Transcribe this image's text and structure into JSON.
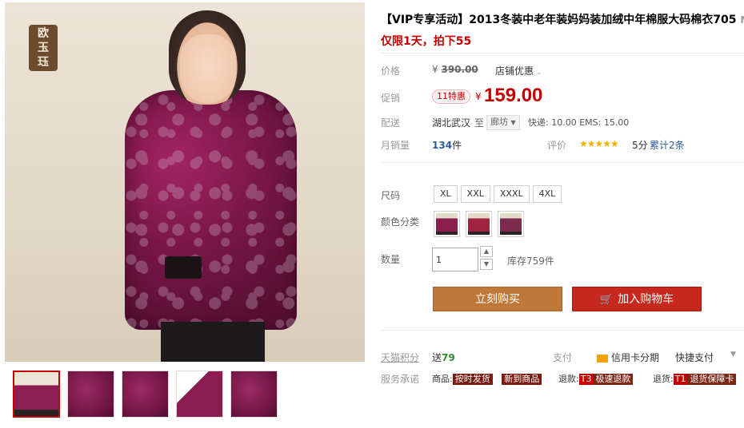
{
  "gallery": {
    "seal_text": "欧玉珏",
    "thumbnails": [
      "thumb-1",
      "thumb-2",
      "thumb-3",
      "thumb-4",
      "thumb-5"
    ]
  },
  "product": {
    "title": "【VIP专享活动】2013冬装中老年装妈妈装加绒中年棉服大码棉衣705",
    "title_suffix": "M",
    "promo_line": "仅限1天，拍下55"
  },
  "price": {
    "label": "价格",
    "currency": "¥",
    "original": "390.00",
    "shop_discount": "店铺优惠",
    "promo_label": "促销",
    "promo_badge": "11特惠",
    "promo_price": "159.00"
  },
  "shipping": {
    "label": "配送",
    "from": "湖北武汉",
    "to_word": "至",
    "destination": "廊坊",
    "fees": "快递: 10.00 EMS: 15.00"
  },
  "sales": {
    "label": "月销量",
    "count": "134",
    "unit": "件",
    "rating_label": "评价",
    "stars": "★★★★★",
    "score": "5分",
    "total": "累计2条"
  },
  "size": {
    "label": "尺码",
    "options": [
      "XL",
      "XXL",
      "XXXL",
      "4XL"
    ]
  },
  "color": {
    "label": "颜色分类"
  },
  "quantity": {
    "label": "数量",
    "value": "1",
    "stock": "库存759件"
  },
  "actions": {
    "buy_now": "立刻购买",
    "add_to_cart": "加入购物车"
  },
  "points": {
    "label": "天猫积分",
    "send": "送",
    "value": "79",
    "pay_label": "支付",
    "credit": "信用卡分期",
    "quick_pay": "快捷支付"
  },
  "service": {
    "label": "服务承诺",
    "goods": "商品:",
    "tag_ship": "按时发货",
    "tag_new": "新到商品",
    "refund": "退款:",
    "t3": "T3",
    "fast_refund": "极速退款",
    "return": "退货:",
    "t1": "T1",
    "return_guarantee": "退货保障卡"
  }
}
